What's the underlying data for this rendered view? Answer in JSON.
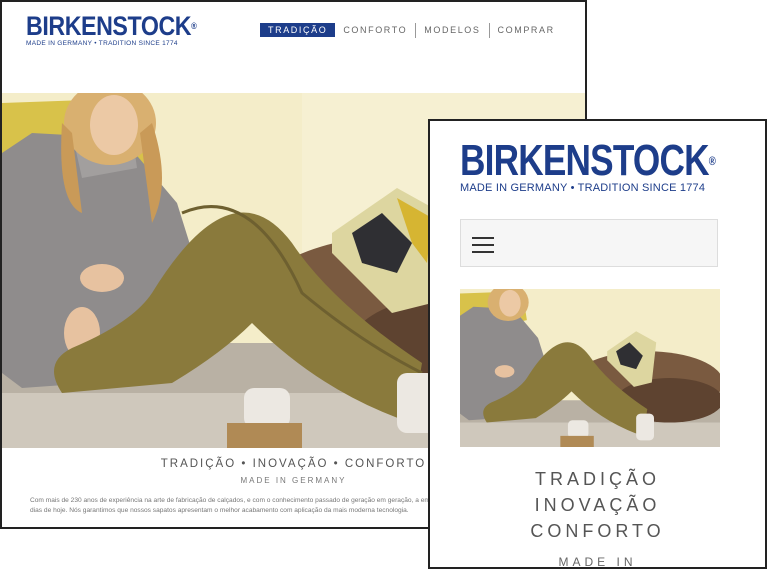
{
  "brand": {
    "name": "BIRKENSTOCK",
    "registered": "®",
    "tagline": "MADE IN GERMANY • TRADITION SINCE 1774",
    "color": "#1d3d8a"
  },
  "desktop": {
    "nav": [
      "TRADIÇÃO",
      "CONFORTO",
      "MODELOS",
      "COMPRAR"
    ],
    "active_nav": "TRADIÇÃO",
    "tagline_row": "TRADIÇÃO  •  INOVAÇÃO  •  CONFORTO",
    "made": "MADE IN GERMANY",
    "paragraph": "Com mais de 230 anos de experiência na arte de fabricação de calçados, e com o conhecimento passado de geração em geração, a empresa familiar, mantendo suas tradições até os dias de hoje. Nós garantimos que nossos sapatos apresentam o melhor acabamento com aplicação da mais moderna tecnologia."
  },
  "mobile": {
    "menu_icon": "hamburger-icon",
    "lines": [
      "TRADIÇÃO",
      "INOVAÇÃO",
      "CONFORTO"
    ],
    "made": "MADE IN"
  }
}
